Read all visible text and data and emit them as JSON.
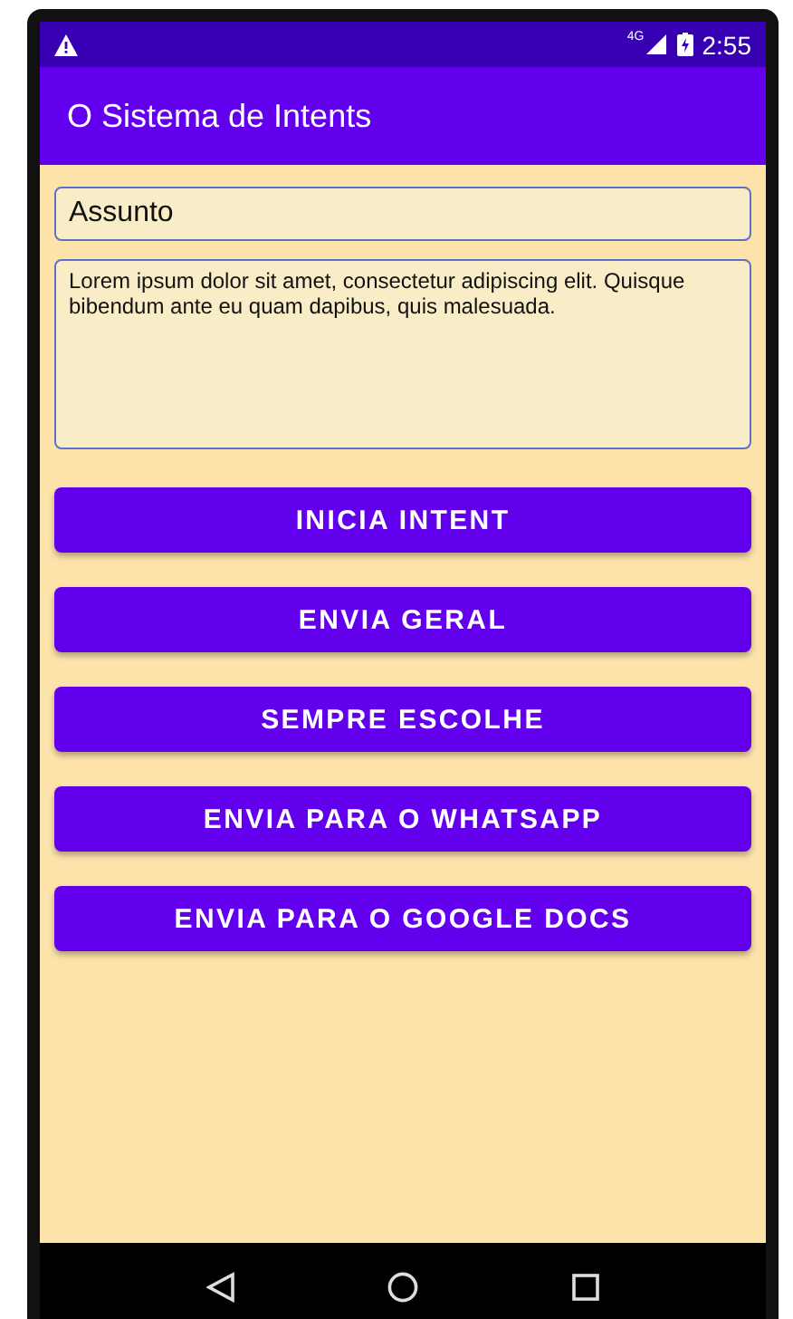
{
  "status_bar": {
    "network": "4G",
    "time": "2:55"
  },
  "app_bar": {
    "title": "O Sistema de Intents"
  },
  "subject_field": {
    "value": "Assunto"
  },
  "body_field": {
    "value": "Lorem ipsum dolor sit amet, consectetur adipiscing elit. Quisque bibendum ante eu quam dapibus, quis malesuada."
  },
  "buttons": [
    {
      "label": "INICIA INTENT"
    },
    {
      "label": "ENVIA GERAL"
    },
    {
      "label": "SEMPRE ESCOLHE"
    },
    {
      "label": "ENVIA PARA O WHATSAPP"
    },
    {
      "label": "ENVIA PARA O GOOGLE DOCS"
    }
  ]
}
